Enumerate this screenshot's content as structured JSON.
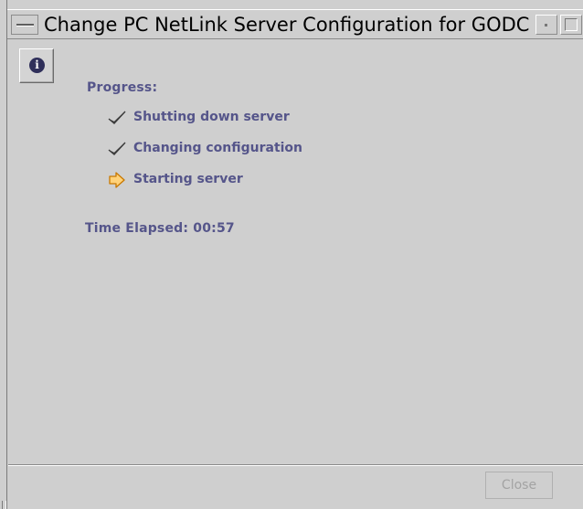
{
  "window": {
    "title": "Change PC NetLink Server Configuration for GODC"
  },
  "progress": {
    "heading": "Progress:",
    "steps": [
      {
        "label": "Shutting down server",
        "status": "done",
        "icon": "check-icon"
      },
      {
        "label": "Changing configuration",
        "status": "done",
        "icon": "check-icon"
      },
      {
        "label": "Starting server",
        "status": "in-progress",
        "icon": "arrow-right-icon"
      }
    ],
    "time_elapsed": "Time Elapsed: 00:57"
  },
  "buttons": {
    "close_label": "Close"
  },
  "colors": {
    "label_text": "#55558a",
    "arrow_fill": "#ffd27a",
    "arrow_stroke": "#c87800",
    "background": "#cfcfcf"
  }
}
